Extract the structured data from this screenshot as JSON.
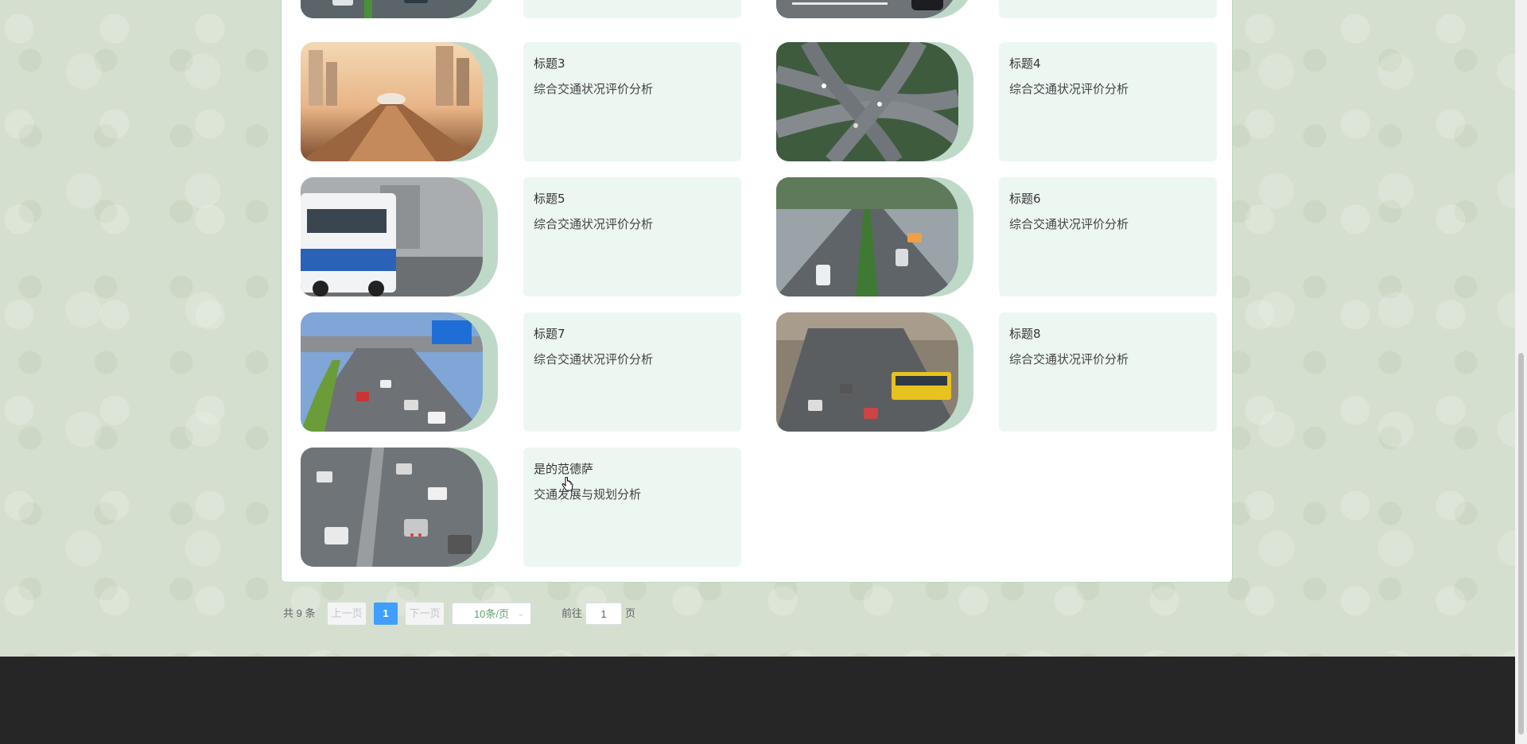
{
  "items": [
    {
      "title": "",
      "subtitle": "",
      "image": "highway-traffic-photo"
    },
    {
      "title": "",
      "subtitle": "",
      "image": "road-car-photo"
    },
    {
      "title": "标题3",
      "subtitle": "综合交通状况评价分析",
      "image": "urban-rail-sunset-photo"
    },
    {
      "title": "标题4",
      "subtitle": "综合交通状况评价分析",
      "image": "interchange-aerial-photo"
    },
    {
      "title": "标题5",
      "subtitle": "综合交通状况评价分析",
      "image": "city-bus-photo"
    },
    {
      "title": "标题6",
      "subtitle": "综合交通状况评价分析",
      "image": "highway-lanes-photo"
    },
    {
      "title": "标题7",
      "subtitle": "综合交通状况评价分析",
      "image": "expressway-cars-photo"
    },
    {
      "title": "标题8",
      "subtitle": "综合交通状况评价分析",
      "image": "traffic-jam-bus-photo"
    },
    {
      "title": "是的范德萨",
      "subtitle": "交通发展与规划分析",
      "image": "dense-traffic-photo"
    }
  ],
  "pagination": {
    "total": "共 9 条",
    "prev": "上一页",
    "current": "1",
    "next": "下一页",
    "page_size": "10条/页",
    "goto_prefix": "前往",
    "goto_value": "1",
    "goto_suffix": "页"
  },
  "colors": {
    "card_bg": "#edf7f2",
    "accent": "#409eff",
    "footer": "#262626"
  }
}
